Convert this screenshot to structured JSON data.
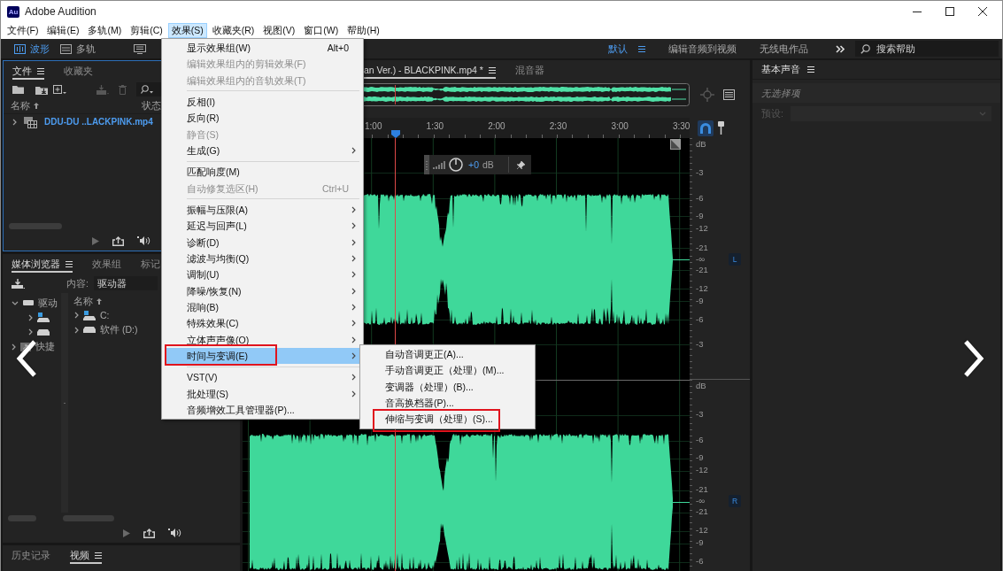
{
  "window": {
    "logo": "Au",
    "title": "Adobe Audition"
  },
  "menu_bar": [
    {
      "label": "文件(F)",
      "selected": false
    },
    {
      "label": "编辑(E)",
      "selected": false
    },
    {
      "label": "多轨(M)",
      "selected": false
    },
    {
      "label": "剪辑(C)",
      "selected": false
    },
    {
      "label": "效果(S)",
      "selected": true
    },
    {
      "label": "收藏夹(R)",
      "selected": false
    },
    {
      "label": "视图(V)",
      "selected": false
    },
    {
      "label": "窗口(W)",
      "selected": false
    },
    {
      "label": "帮助(H)",
      "selected": false
    }
  ],
  "toolbar": {
    "views": [
      {
        "kind": "waveform",
        "label": "波形",
        "selected": true
      },
      {
        "kind": "multitrack",
        "label": "多轨",
        "selected": false
      }
    ],
    "workspaces": [
      {
        "label": "默认",
        "selected": true
      },
      {
        "label": "编辑音频到视频",
        "selected": false
      },
      {
        "label": "无线电作品",
        "selected": false
      }
    ],
    "search": {
      "placeholder": "搜索帮助"
    }
  },
  "files_panel": {
    "focused": true,
    "tabs": [
      {
        "label": "文件",
        "selected": true
      },
      {
        "label": "收藏夹",
        "selected": false
      }
    ],
    "columns": [
      "名称",
      "状态"
    ],
    "items": [
      {
        "name": "DDU-DU ..LACKPINK.mp4",
        "expanded": false
      }
    ]
  },
  "media_browser": {
    "tabs": [
      {
        "label": "媒体浏览器",
        "selected": true
      },
      {
        "label": "效果组",
        "selected": false
      },
      {
        "label": "标记",
        "selected": false
      }
    ],
    "content": {
      "label": "内容:",
      "value": "驱动器"
    },
    "tree": [
      {
        "kind": "drives",
        "label": "驱动",
        "expanded": true,
        "children": [
          {
            "kind": "system",
            "expanded": false
          },
          {
            "kind": "drive",
            "expanded": false
          }
        ]
      },
      {
        "kind": "shortcuts",
        "label": "快捷",
        "expanded": false
      }
    ],
    "column": "名称",
    "items": [
      {
        "kind": "system",
        "label": "C:",
        "expanded": false
      },
      {
        "kind": "drive",
        "label": "软件 (D:)",
        "expanded": false
      }
    ]
  },
  "bottom_tabs": [
    {
      "label": "历史记录",
      "selected": false
    },
    {
      "label": "视频",
      "selected": true
    }
  ],
  "editor": {
    "tabs": [
      {
        "label": "an Ver.) - BLACKPINK.mp4 *",
        "selected": true
      },
      {
        "label": "混音器",
        "selected": false
      }
    ],
    "ruler": [
      "1:00",
      "1:30",
      "2:00",
      "2:30",
      "3:00",
      "3:30"
    ],
    "hud": {
      "gain": "+0",
      "unit": "dB"
    },
    "channels": [
      {
        "label": "L",
        "scale": [
          "dB",
          "-3",
          "-6",
          "-9",
          "-12",
          "-21",
          "-∞",
          "-21",
          "-12",
          "-9",
          "-6",
          "-3"
        ]
      },
      {
        "label": "R",
        "scale": [
          "dB",
          "-3",
          "-6",
          "-9",
          "-12",
          "-21",
          "-∞",
          "-21",
          "-12",
          "-9",
          "-6"
        ]
      }
    ]
  },
  "essential_sound": {
    "title": "基本声音",
    "status": "无选择项",
    "preset": {
      "label": "预设:",
      "disabled": true
    }
  },
  "effects_menu": {
    "groups": [
      [
        {
          "label": "显示效果组(W)",
          "shortcut": "Alt+0",
          "disabled": false,
          "has_submenu": false,
          "selected": false,
          "boxed": false
        },
        {
          "label": "编辑效果组内的剪辑效果(F)",
          "disabled": true,
          "has_submenu": false,
          "selected": false,
          "boxed": false
        },
        {
          "label": "编辑效果组内的音轨效果(T)",
          "disabled": true,
          "has_submenu": false,
          "selected": false,
          "boxed": false
        }
      ],
      [
        {
          "label": "反相(I)",
          "disabled": false,
          "has_submenu": false,
          "selected": false,
          "boxed": false
        },
        {
          "label": "反向(R)",
          "disabled": false,
          "has_submenu": false,
          "selected": false,
          "boxed": false
        },
        {
          "label": "静音(S)",
          "disabled": true,
          "has_submenu": false,
          "selected": false,
          "boxed": false
        },
        {
          "label": "生成(G)",
          "disabled": false,
          "has_submenu": true,
          "selected": false,
          "boxed": false
        }
      ],
      [
        {
          "label": "匹配响度(M)",
          "disabled": false,
          "has_submenu": false,
          "selected": false,
          "boxed": false
        },
        {
          "label": "自动修复选区(H)",
          "shortcut": "Ctrl+U",
          "disabled": true,
          "has_submenu": false,
          "selected": false,
          "boxed": false
        }
      ],
      [
        {
          "label": "振幅与压限(A)",
          "disabled": false,
          "has_submenu": true,
          "selected": false,
          "boxed": false
        },
        {
          "label": "延迟与回声(L)",
          "disabled": false,
          "has_submenu": true,
          "selected": false,
          "boxed": false
        },
        {
          "label": "诊断(D)",
          "disabled": false,
          "has_submenu": true,
          "selected": false,
          "boxed": false
        },
        {
          "label": "滤波与均衡(Q)",
          "disabled": false,
          "has_submenu": true,
          "selected": false,
          "boxed": false
        },
        {
          "label": "调制(U)",
          "disabled": false,
          "has_submenu": true,
          "selected": false,
          "boxed": false
        },
        {
          "label": "降噪/恢复(N)",
          "disabled": false,
          "has_submenu": true,
          "selected": false,
          "boxed": false
        },
        {
          "label": "混响(B)",
          "disabled": false,
          "has_submenu": true,
          "selected": false,
          "boxed": false
        },
        {
          "label": "特殊效果(C)",
          "disabled": false,
          "has_submenu": true,
          "selected": false,
          "boxed": false
        },
        {
          "label": "立体声声像(O)",
          "disabled": false,
          "has_submenu": true,
          "selected": false,
          "boxed": false
        },
        {
          "label": "时间与变调(E)",
          "disabled": false,
          "has_submenu": true,
          "selected": true,
          "boxed": true
        }
      ],
      [
        {
          "label": "VST(V)",
          "disabled": false,
          "has_submenu": true,
          "selected": false,
          "boxed": false
        },
        {
          "label": "批处理(S)",
          "disabled": false,
          "has_submenu": true,
          "selected": false,
          "boxed": false
        },
        {
          "label": "音频增效工具管理器(P)...",
          "disabled": false,
          "has_submenu": false,
          "selected": false,
          "boxed": false
        }
      ]
    ]
  },
  "time_pitch_submenu": {
    "items": [
      {
        "label": "自动音调更正(A)...",
        "selected": false,
        "boxed": false
      },
      {
        "label": "手动音调更正（处理）(M)...",
        "selected": false,
        "boxed": false
      },
      {
        "label": "变调器（处理）(B)...",
        "selected": false,
        "boxed": false
      },
      {
        "label": "音高换档器(P)...",
        "selected": false,
        "boxed": false
      },
      {
        "label": "伸缩与变调（处理）(S)...",
        "selected": false,
        "boxed": true
      }
    ]
  }
}
